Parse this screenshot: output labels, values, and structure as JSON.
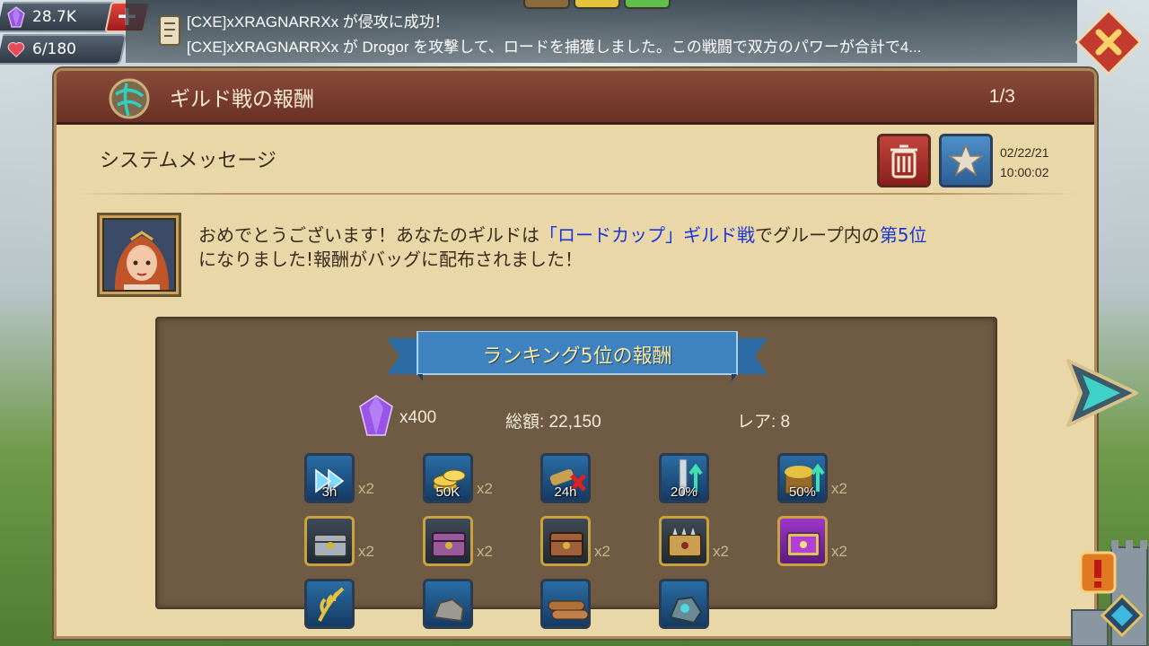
{
  "resources": {
    "gems": "28.7K",
    "hearts": "6/180",
    "plus_label": "+"
  },
  "news": {
    "line1": "[CXE]xXRAGNARRXx が侵攻に成功！",
    "line2": "[CXE]xXRAGNARRXx が Drogor を攻撃して、ロードを捕獲しました。この戦闘で双方のパワーが合計で4..."
  },
  "header": {
    "title": "ギルド戦の報酬",
    "page_count": "1/3"
  },
  "mail": {
    "subject": "システムメッセージ",
    "date": "02/22/21",
    "time": "10:00:02",
    "message_part1": "おめでとうございます！あなたのギルドは",
    "message_highlight1": "「ロードカップ」ギルド戦",
    "message_part2": "でグループ内の",
    "message_highlight2": "第5位",
    "message_part3": "になりました!報酬がバッグに配布されました！"
  },
  "rewards": {
    "banner": "ランキング5位の報酬",
    "gems": "x400",
    "total": "総額: 22,150",
    "rarity": "レア: 8",
    "items": [
      {
        "icon": "speedup-icon",
        "badge": "3h",
        "qty": "x2",
        "frame": "blue"
      },
      {
        "icon": "gold-coins-icon",
        "badge": "50K",
        "qty": "x2",
        "frame": "blue"
      },
      {
        "icon": "anti-scout-icon",
        "badge": "24h",
        "qty": "",
        "frame": "blue"
      },
      {
        "icon": "attack-boost-icon",
        "badge": "20%",
        "qty": "",
        "frame": "blue"
      },
      {
        "icon": "gathering-boost-icon",
        "badge": "50%",
        "qty": "x2",
        "frame": "blue"
      },
      {
        "icon": "chest-silver-icon",
        "badge": "",
        "qty": "x2",
        "frame": "gold"
      },
      {
        "icon": "chest-purple-icon",
        "badge": "",
        "qty": "x2",
        "frame": "gold"
      },
      {
        "icon": "chest-bronze-icon",
        "badge": "",
        "qty": "x2",
        "frame": "gold"
      },
      {
        "icon": "chest-spiked-icon",
        "badge": "",
        "qty": "x2",
        "frame": "gold"
      },
      {
        "icon": "chest-epic-icon",
        "badge": "",
        "qty": "x2",
        "frame": "purple"
      },
      {
        "icon": "food-icon",
        "badge": "",
        "qty": "",
        "frame": "blue"
      },
      {
        "icon": "stone-icon",
        "badge": "",
        "qty": "",
        "frame": "blue"
      },
      {
        "icon": "timber-icon",
        "badge": "",
        "qty": "",
        "frame": "blue"
      },
      {
        "icon": "ore-icon",
        "badge": "",
        "qty": "",
        "frame": "blue"
      }
    ]
  },
  "colors": {
    "header_bg": "#7a3d30",
    "panel_bg": "#ead7a8",
    "highlight_text": "#1a36d8",
    "reward_bg": "#6f5a43",
    "ribbon": "#3f82c0"
  }
}
